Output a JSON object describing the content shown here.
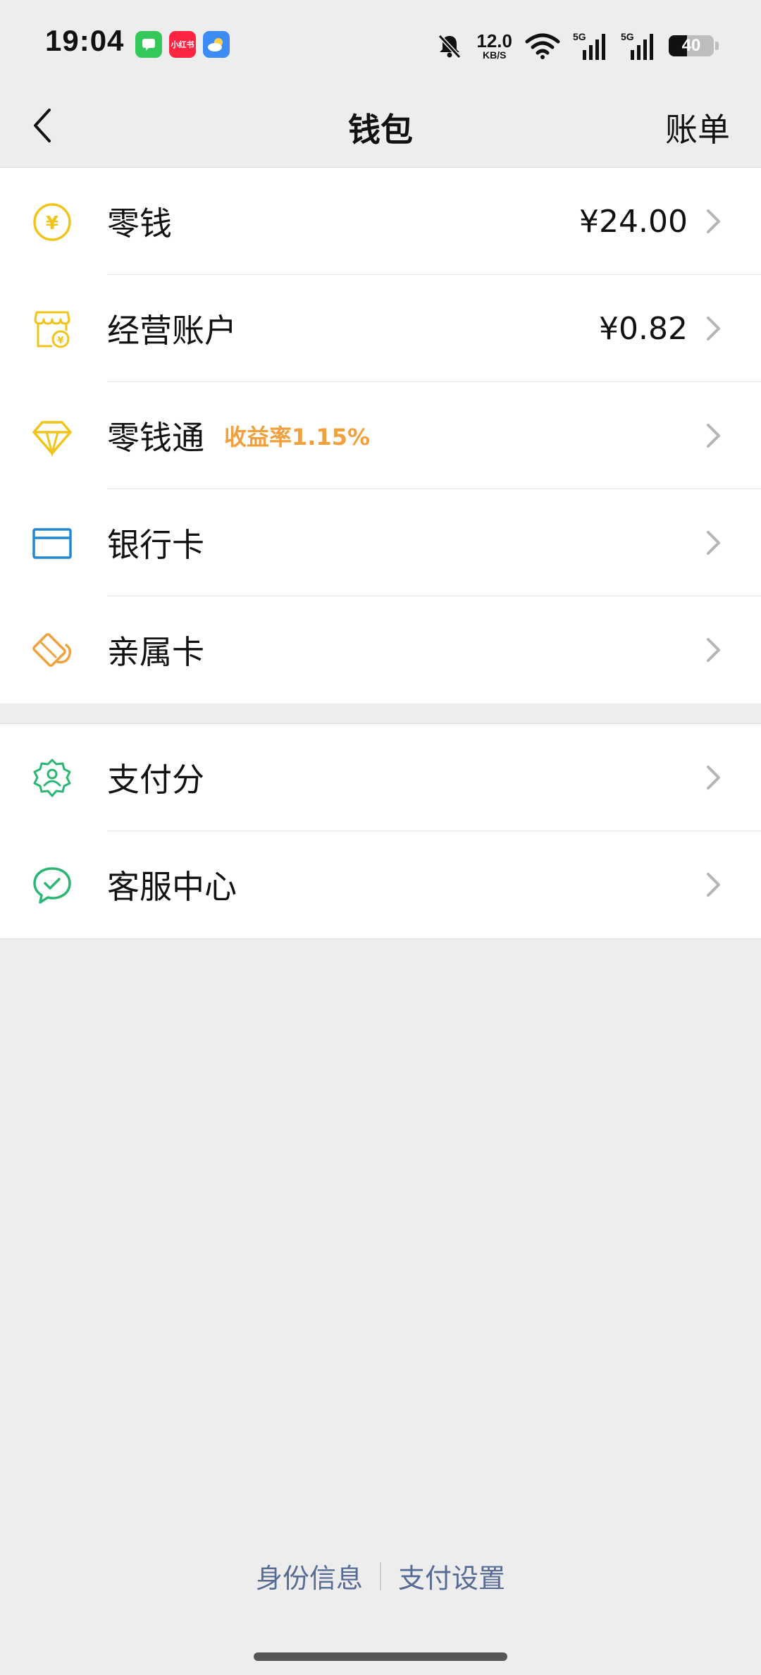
{
  "status_bar": {
    "time": "19:04",
    "net_speed_value": "12.0",
    "net_speed_unit": "KB/S",
    "battery_level": "40",
    "app_icons": [
      "messages-icon",
      "xiaohongshu-icon",
      "weather-icon"
    ],
    "xiaohongshu_label": "小红书"
  },
  "nav": {
    "title": "钱包",
    "right": "账单"
  },
  "group_one": [
    {
      "label": "零钱",
      "value": "¥24.00",
      "icon": "coin-icon",
      "color": "#f0c419"
    },
    {
      "label": "经营账户",
      "value": "¥0.82",
      "icon": "shop-icon",
      "color": "#f0c419"
    },
    {
      "label": "零钱通",
      "badge": "收益率1.15%",
      "icon": "diamond-icon",
      "color": "#f0c419"
    },
    {
      "label": "银行卡",
      "icon": "card-icon",
      "color": "#1e88d4"
    },
    {
      "label": "亲属卡",
      "icon": "family-card-icon",
      "color": "#f0a03c"
    }
  ],
  "group_two": [
    {
      "label": "支付分",
      "icon": "pay-score-icon",
      "color": "#2bb673"
    },
    {
      "label": "客服中心",
      "icon": "service-icon",
      "color": "#2bb673"
    }
  ],
  "footer": {
    "identity": "身份信息",
    "settings": "支付设置"
  },
  "colors": {
    "background": "#ededed",
    "link": "#576b95",
    "badge": "#f0a03c"
  }
}
